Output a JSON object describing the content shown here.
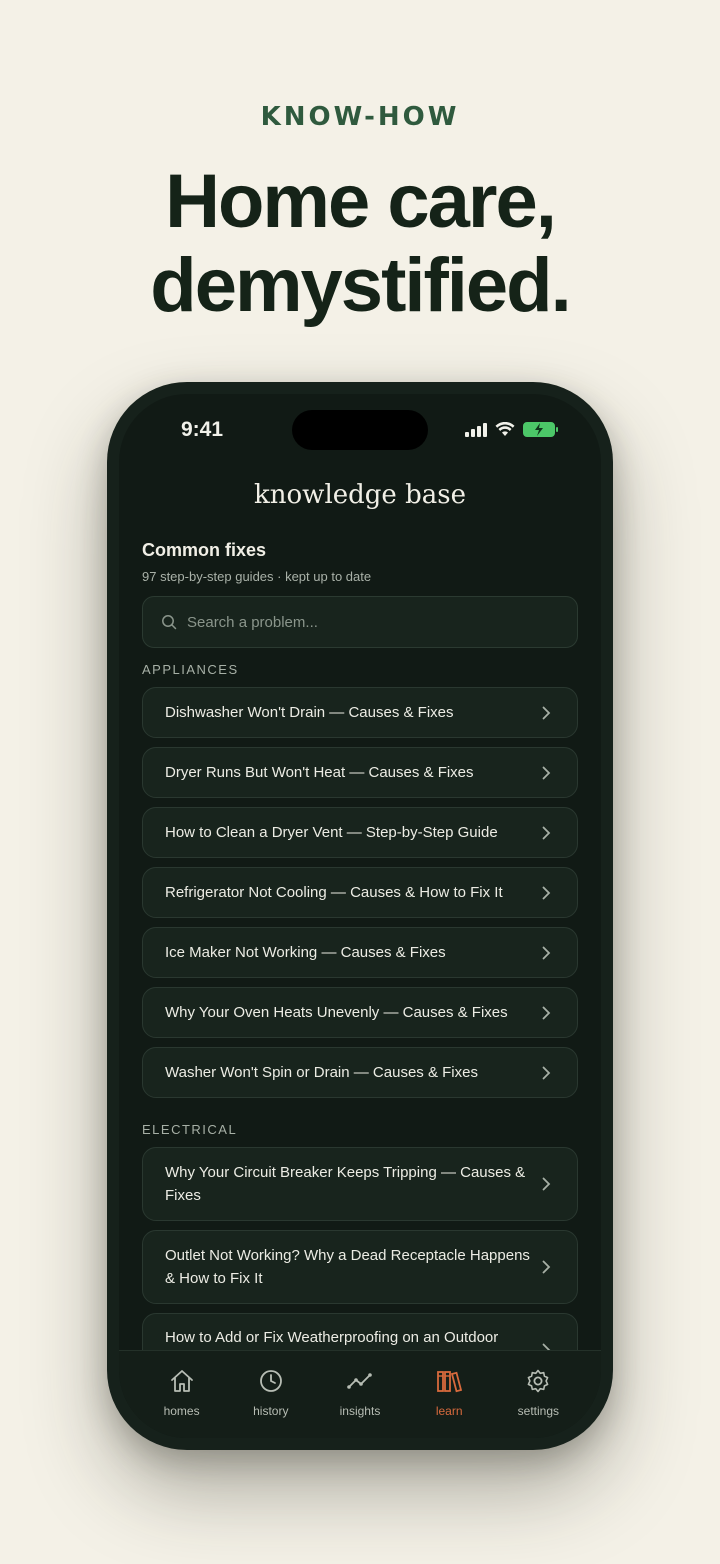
{
  "hero": {
    "eyebrow": "KNOW-HOW",
    "headline_line1": "Home care,",
    "headline_line2": "demystified."
  },
  "status_bar": {
    "time": "9:41"
  },
  "app": {
    "title": "knowledge base"
  },
  "section": {
    "title": "Common fixes",
    "subtitle": "97 step-by-step guides · kept up to date"
  },
  "search": {
    "placeholder": "Search a problem..."
  },
  "categories": [
    {
      "name": "APPLIANCES",
      "items": [
        "Dishwasher Won't Drain — Causes & Fixes",
        "Dryer Runs But Won't Heat — Causes & Fixes",
        "How to Clean a Dryer Vent — Step-by-Step Guide",
        "Refrigerator Not Cooling — Causes & How to Fix It",
        "Ice Maker Not Working — Causes & Fixes",
        "Why Your Oven Heats Unevenly — Causes & Fixes",
        "Washer Won't Spin or Drain — Causes & Fixes"
      ]
    },
    {
      "name": "ELECTRICAL",
      "items": [
        "Why Your Circuit Breaker Keeps Tripping — Causes & Fixes",
        "Outlet Not Working? Why a Dead Receptacle Happens & How to Fix It",
        "How to Add or Fix Weatherproofing on an Outdoor"
      ]
    }
  ],
  "tabs": [
    {
      "label": "homes",
      "icon": "home-icon"
    },
    {
      "label": "history",
      "icon": "clock-icon"
    },
    {
      "label": "insights",
      "icon": "chart-line-icon"
    },
    {
      "label": "learn",
      "icon": "books-icon",
      "active": true
    },
    {
      "label": "settings",
      "icon": "gear-icon"
    }
  ],
  "colors": {
    "accent": "#d86a3d",
    "brand_green": "#2f5a3e",
    "battery": "#4cc768"
  }
}
